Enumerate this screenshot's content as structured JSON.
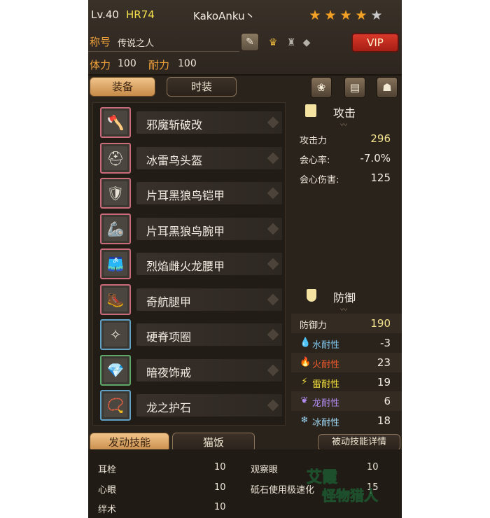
{
  "header": {
    "level": "Lv.40",
    "hr": "HR74",
    "player_name": "KakoAnku丶",
    "stars_on": 4,
    "stars_total": 5,
    "title_label": "称号",
    "title_value": "传说之人",
    "vip_label": "VIP",
    "stamina_label": "体力",
    "stamina_value": "100",
    "endurance_label": "耐力",
    "endurance_value": "100"
  },
  "tabs": {
    "equipment": "装备",
    "fashion": "时装",
    "active_skills": "发动技能",
    "cat_meal": "猫饭",
    "passive_detail": "被动技能详情"
  },
  "equipment": [
    {
      "name": "邪魔斩破改",
      "icon": "weapon-axe-icon",
      "frame": "red",
      "glyph": "🪓"
    },
    {
      "name": "冰雷鸟头盔",
      "icon": "helmet-icon",
      "frame": "red",
      "glyph": "⛑"
    },
    {
      "name": "片耳黑狼鸟铠甲",
      "icon": "chest-armor-icon",
      "frame": "red",
      "glyph": "🛡"
    },
    {
      "name": "片耳黑狼鸟腕甲",
      "icon": "arm-armor-icon",
      "frame": "red",
      "glyph": "🦾"
    },
    {
      "name": "烈焰雌火龙腰甲",
      "icon": "waist-armor-icon",
      "frame": "red",
      "glyph": "🩳"
    },
    {
      "name": "奇航腿甲",
      "icon": "leg-armor-icon",
      "frame": "red",
      "glyph": "🥾"
    },
    {
      "name": "硬脊项圈",
      "icon": "necklace-icon",
      "frame": "blue",
      "glyph": "✧"
    },
    {
      "name": "暗夜饰戒",
      "icon": "ring-icon",
      "frame": "green",
      "glyph": "💎"
    },
    {
      "name": "龙之护石",
      "icon": "talisman-icon",
      "frame": "blue",
      "glyph": "📿"
    }
  ],
  "attack": {
    "header": "攻击",
    "rows": [
      {
        "label": "攻击力",
        "value": "296"
      },
      {
        "label": "会心率:",
        "value": "-7.0%"
      },
      {
        "label": "会心伤害:",
        "value": "125"
      }
    ]
  },
  "defense": {
    "header": "防御",
    "defense_label": "防御力",
    "defense_value": "190",
    "resistances": [
      {
        "label": "水耐性",
        "value": "-3",
        "icon": "water-drop-icon",
        "color": "#7ec8f0",
        "glyph": "💧"
      },
      {
        "label": "火耐性",
        "value": "23",
        "icon": "fire-icon",
        "color": "#ef5a2b",
        "glyph": "🔥"
      },
      {
        "label": "雷耐性",
        "value": "19",
        "icon": "thunder-icon",
        "color": "#f5e13a",
        "glyph": "⚡"
      },
      {
        "label": "龙耐性",
        "value": "6",
        "icon": "dragon-icon",
        "color": "#b28cf0",
        "glyph": "❦"
      },
      {
        "label": "冰耐性",
        "value": "18",
        "icon": "ice-icon",
        "color": "#9fd8f5",
        "glyph": "❄"
      }
    ]
  },
  "skills": [
    {
      "name": "耳栓",
      "value": "10"
    },
    {
      "name": "心眼",
      "value": "10"
    },
    {
      "name": "绊术",
      "value": "10"
    },
    {
      "name": "观察眼",
      "value": "10"
    },
    {
      "name": "砥石使用极速化",
      "value": "15"
    }
  ],
  "watermark": {
    "line1": "艾霞",
    "line2": "怪物猎人"
  }
}
